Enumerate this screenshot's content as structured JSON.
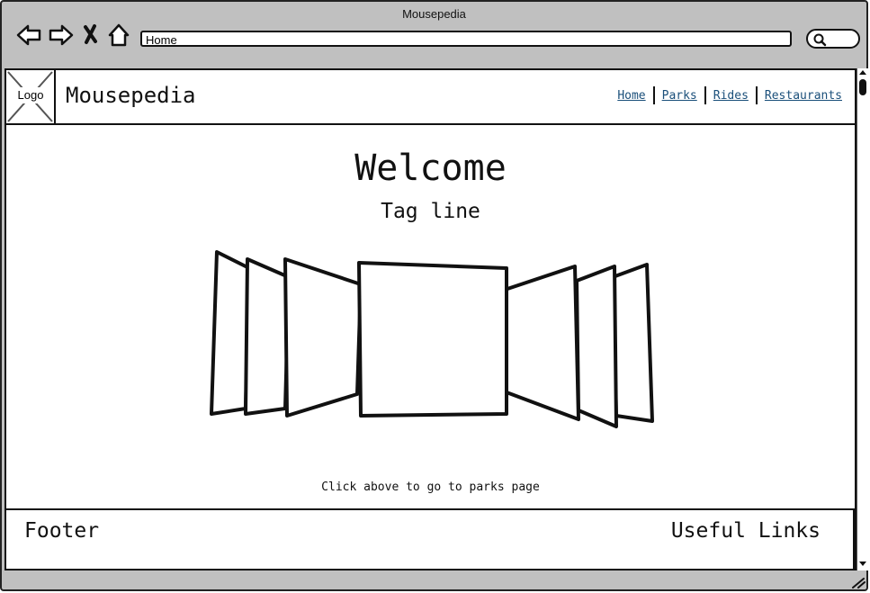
{
  "browser": {
    "window_title": "Mousepedia",
    "url": "Home",
    "icons": [
      "back-arrow-icon",
      "forward-arrow-icon",
      "stop-icon",
      "home-icon",
      "search-icon"
    ]
  },
  "header": {
    "logo_label": "Logo",
    "site_name": "Mousepedia",
    "nav": [
      {
        "label": "Home"
      },
      {
        "label": "Parks"
      },
      {
        "label": "Rides"
      },
      {
        "label": "Restaurants"
      }
    ]
  },
  "main": {
    "title": "Welcome",
    "tagline": "Tag line",
    "caption": "Click above to go to parks page"
  },
  "footer": {
    "left": "Footer",
    "right": "Useful Links"
  },
  "colors": {
    "chrome": "#c0c0c0",
    "link": "#1a4f7a",
    "stroke": "#111111"
  }
}
